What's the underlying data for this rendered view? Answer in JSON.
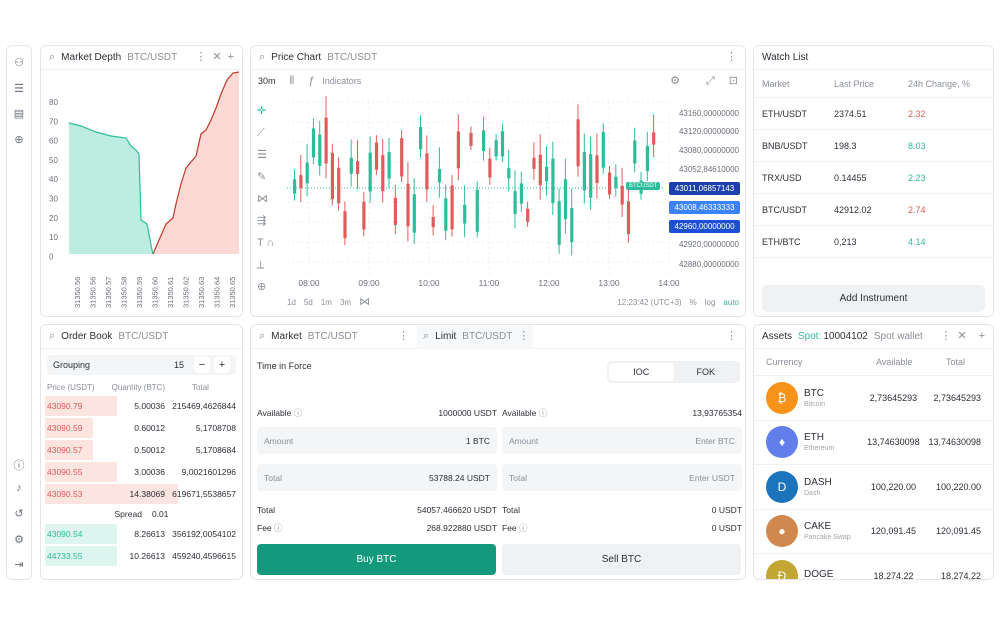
{
  "colors": {
    "buy": "#14997d",
    "up": "#2ebd9b",
    "down": "#e05c5c",
    "accent_blue": "#2563eb"
  },
  "sidebar": {
    "top_icons": [
      "user-search-icon",
      "menu-icon",
      "layers-icon",
      "add-circle-icon"
    ],
    "bottom_icons": [
      "help-icon",
      "bell-icon",
      "history-icon",
      "settings-icon",
      "logout-icon"
    ]
  },
  "depth": {
    "title": "Market Depth",
    "pair": "BTC/USDT",
    "y_ticks": [
      "80",
      "70",
      "60",
      "50",
      "40",
      "30",
      "20",
      "10",
      "0"
    ],
    "x_ticks": [
      "31350.56",
      "31350.56",
      "31350.57",
      "31350.58",
      "31350.59",
      "31350.60",
      "31350.61",
      "31350.62",
      "31350.63",
      "31350.64",
      "31350.65"
    ]
  },
  "chart": {
    "title": "Price Chart",
    "pair": "BTC/USDT",
    "interval": "30m",
    "indicators": "Indicators",
    "price_ticks": [
      "43160,00000000",
      "43120,00000000",
      "43080,00000000",
      "43052,84610000",
      "43000,00000000",
      "42960,00000000",
      "42920,00000000",
      "42880,00000000"
    ],
    "tag_pair": "BTCUSDT",
    "tags": [
      "43011,06857143",
      "43008,46333333",
      "42960,00000000"
    ],
    "time_ticks": [
      "08:00",
      "09:00",
      "10:00",
      "11:00",
      "12:00",
      "13:00",
      "14:00"
    ],
    "ranges": [
      "1d",
      "5d",
      "1m",
      "3m"
    ],
    "clock": "12:23:42 (UTC+3)",
    "scale_opts": [
      "%",
      "log",
      "auto"
    ]
  },
  "watch": {
    "title": "Watch List",
    "headers": [
      "Market",
      "Last Price",
      "24h Change, %"
    ],
    "rows": [
      {
        "market": "ETH/USDT",
        "price": "2374.51",
        "change": "2.32",
        "dir": "down"
      },
      {
        "market": "BNB/USDT",
        "price": "198.3",
        "change": "8.03",
        "dir": "up"
      },
      {
        "market": "TRX/USD",
        "price": "0.14455",
        "change": "2.23",
        "dir": "up"
      },
      {
        "market": "BTC/USDT",
        "price": "42912.02",
        "change": "2.74",
        "dir": "down"
      },
      {
        "market": "ETH/BTC",
        "price": "0,213",
        "change": "4.14",
        "dir": "up"
      }
    ],
    "add_label": "Add Instrument"
  },
  "book": {
    "title": "Order Book",
    "pair": "BTC/USDT",
    "grouping_label": "Grouping",
    "grouping_value": "15",
    "headers": [
      "Price (USDT)",
      "Quantity (BTC)",
      "Total"
    ],
    "asks": [
      {
        "price": "43090.79",
        "qty": "5.00036",
        "total": "215469,4626844",
        "depth": 0.36
      },
      {
        "price": "43090.59",
        "qty": "0.60012",
        "total": "5,1708708",
        "depth": 0.24
      },
      {
        "price": "43090.57",
        "qty": "0.50012",
        "total": "5,1708684",
        "depth": 0.24
      },
      {
        "price": "43090.55",
        "qty": "3.00036",
        "total": "9,0021601296",
        "depth": 0.36
      },
      {
        "price": "43090.53",
        "qty": "14.38069",
        "total": "619671,5538657",
        "depth": 0.66
      }
    ],
    "spread_label": "Spread",
    "spread_value": "0.01",
    "bids": [
      {
        "price": "43090.54",
        "qty": "8.26613",
        "total": "356192,0054102",
        "depth": 0.36
      },
      {
        "price": "44733.55",
        "qty": "10.26613",
        "total": "459240,4596615",
        "depth": 0.36
      }
    ]
  },
  "trade": {
    "tab1": "Market",
    "tab1_pair": "BTC/USDT",
    "tab2": "Limit",
    "tab2_pair": "BTC/USDT",
    "tif_label": "Time in Force",
    "tif_opts": [
      "IOC",
      "FOK"
    ],
    "buy": {
      "available_label": "Available",
      "available": "1000000 USDT",
      "amount_label": "Amount",
      "amount": "1 BTC",
      "total_label": "Total",
      "total": "53788.24 USDT",
      "sum_label": "Total",
      "sum": "54057.466620 USDT",
      "fee_label": "Fee",
      "fee": "268.922880 USDT",
      "button": "Buy BTC"
    },
    "sell": {
      "available_label": "Available",
      "available": "13,93765354",
      "amount_label": "Amount",
      "amount": "Enter BTC",
      "total_label": "Total",
      "total": "Enter USDT",
      "sum_label": "Total",
      "sum": "0 USDT",
      "fee_label": "Fee",
      "fee": "0 USDT",
      "button": "Sell BTC"
    }
  },
  "assets": {
    "title": "Assets",
    "spot_label": "Spot:",
    "spot_value": "10004102",
    "spot_wallet": "Spot wallet",
    "headers": [
      "Currency",
      "Available",
      "Total"
    ],
    "rows": [
      {
        "sym": "BTC",
        "name": "Bitcoin",
        "available": "2,73645293",
        "total": "2,73645293",
        "color": "#f7931a",
        "glyph": "₿"
      },
      {
        "sym": "ETH",
        "name": "Ethereum",
        "available": "13,74630098",
        "total": "13,74630098",
        "color": "#627eea",
        "glyph": "♦"
      },
      {
        "sym": "DASH",
        "name": "Dash",
        "available": "100,220.00",
        "total": "100,220.00",
        "color": "#1c75bc",
        "glyph": "D"
      },
      {
        "sym": "CAKE",
        "name": "Pancake Swap",
        "available": "120,091.45",
        "total": "120,091.45",
        "color": "#d1884f",
        "glyph": "●"
      },
      {
        "sym": "DOGE",
        "name": "",
        "available": "18,274.22",
        "total": "18,274.22",
        "color": "#c2a633",
        "glyph": "Ð"
      }
    ]
  }
}
